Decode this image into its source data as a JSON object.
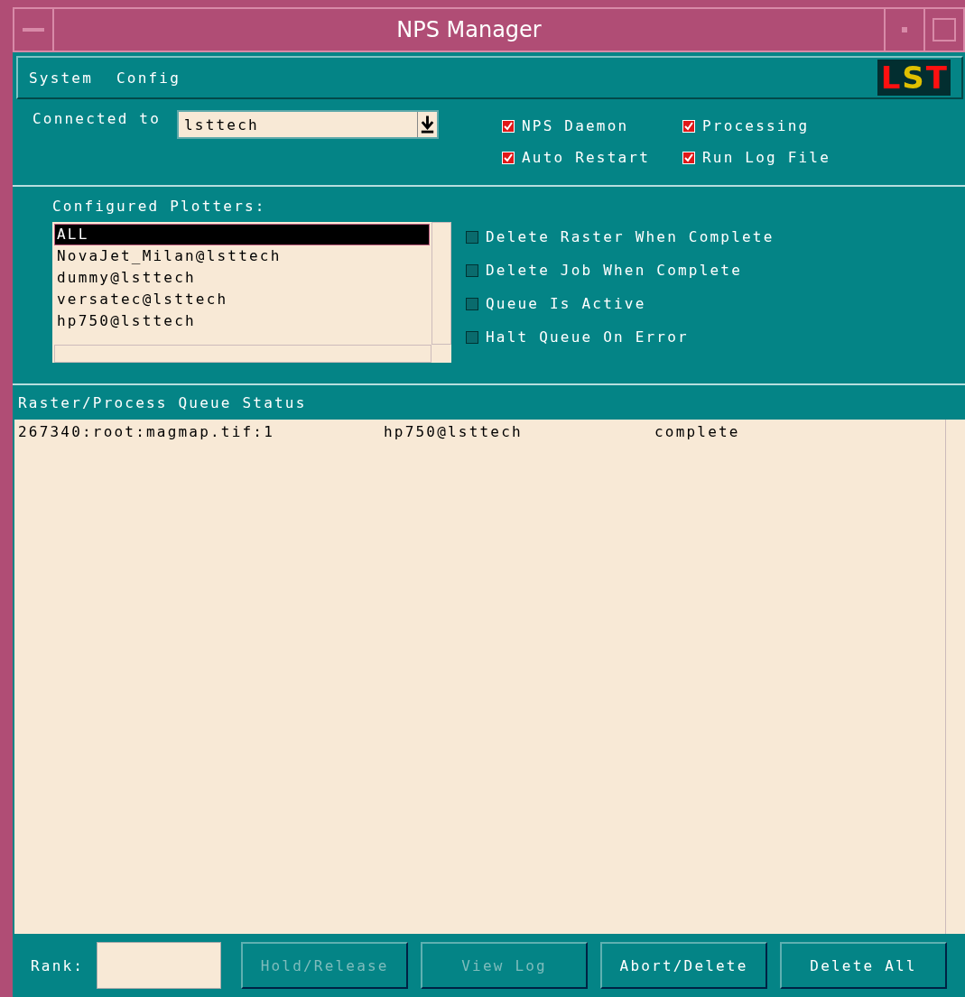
{
  "window": {
    "title": "NPS Manager"
  },
  "menu": [
    {
      "label": "System"
    },
    {
      "label": "Config"
    }
  ],
  "logo": "LST",
  "connection": {
    "label": "Connected to",
    "value": "lsttech"
  },
  "daemon_options": [
    {
      "label": "NPS Daemon",
      "checked": true
    },
    {
      "label": "Processing",
      "checked": true
    },
    {
      "label": "Auto Restart",
      "checked": true
    },
    {
      "label": "Run Log File",
      "checked": true
    }
  ],
  "plotters": {
    "label": "Configured Plotters:",
    "items": [
      {
        "label": "ALL",
        "selected": true
      },
      {
        "label": "NovaJet_Milan@lsttech",
        "selected": false
      },
      {
        "label": "dummy@lsttech",
        "selected": false
      },
      {
        "label": "versatec@lsttech",
        "selected": false
      },
      {
        "label": "hp750@lsttech",
        "selected": false
      }
    ]
  },
  "queue_options": [
    {
      "label": "Delete Raster When Complete",
      "checked": false
    },
    {
      "label": "Delete Job When Complete",
      "checked": false
    },
    {
      "label": "Queue Is Active",
      "checked": false
    },
    {
      "label": "Halt Queue On Error",
      "checked": false
    }
  ],
  "queue": {
    "label": "Raster/Process Queue Status",
    "rows": [
      {
        "job": "267340:root:magmap.tif:1",
        "plotter": "hp750@lsttech",
        "status": "complete"
      }
    ]
  },
  "rank": {
    "label": "Rank:"
  },
  "buttons": [
    {
      "label": "Hold/Release",
      "disabled": true
    },
    {
      "label": "View Log",
      "disabled": true
    },
    {
      "label": "Abort/Delete",
      "disabled": false
    },
    {
      "label": "Delete All",
      "disabled": false
    }
  ]
}
